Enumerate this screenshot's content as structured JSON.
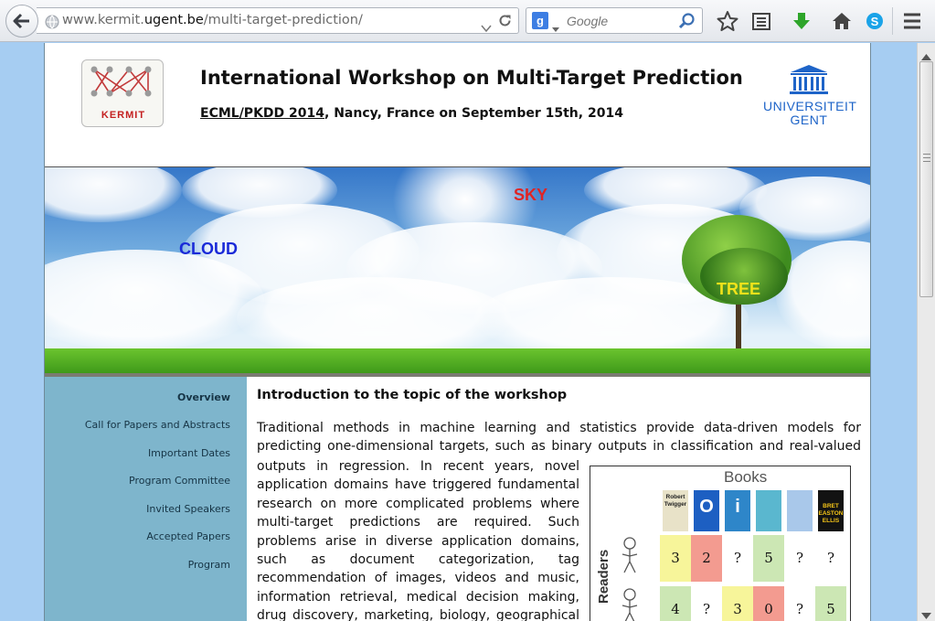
{
  "browser": {
    "url_prefix": "www.kermit.",
    "url_host": "ugent.be",
    "url_path": "/multi-target-prediction/",
    "search_placeholder": "Google",
    "search_engine_glyph": "g"
  },
  "header": {
    "logo_text": "KERMIT",
    "title": "International Workshop on Multi-Target Prediction",
    "conference_link": "ECML/PKDD 2014",
    "subtitle_rest": ", Nancy, France on September 15th, 2014",
    "university_line1": "UNIVERSITEIT",
    "university_line2": "GENT"
  },
  "banner": {
    "sky_label": "SKY",
    "cloud_label": "CLOUD",
    "tree_label": "TREE"
  },
  "sidebar": {
    "items": [
      {
        "label": "Overview",
        "active": true
      },
      {
        "label": "Call for Papers and Abstracts",
        "active": false
      },
      {
        "label": "Important Dates",
        "active": false
      },
      {
        "label": "Program Committee",
        "active": false
      },
      {
        "label": "Invited Speakers",
        "active": false
      },
      {
        "label": "Accepted Papers",
        "active": false
      },
      {
        "label": "Program",
        "active": false
      }
    ]
  },
  "content": {
    "heading": "Introduction to the topic of the workshop",
    "para_full": "Traditional methods in machine learning and statistics provide data-driven models for predicting one-dimensional targets, such as binary outputs in classification and real-valued",
    "para_lines": [
      "outputs in regression. In recent years, novel",
      "application domains have triggered fundamental",
      "research on more complicated problems where",
      "multi-target predictions are required. Such",
      "problems arise in diverse application domains,",
      "such as document categorization, tag",
      "recommendation of images, videos and music,",
      "information retrieval, medical decision making,",
      "drug discovery, marketing, biology, geographical"
    ]
  },
  "figure": {
    "title": "Books",
    "row_label": "Readers",
    "book_covers": [
      {
        "label": "Robert Twigger",
        "color": "#e8e2c8"
      },
      {
        "label": "O",
        "color": "#1d5fc2"
      },
      {
        "label": "i",
        "color": "#2e86c9"
      },
      {
        "label": "",
        "color": "#5ab7cf"
      },
      {
        "label": "",
        "color": "#a9c8ea"
      },
      {
        "label": "BRET EASTON ELLIS",
        "color": "#121212"
      }
    ],
    "rows": [
      {
        "cells": [
          {
            "v": "3",
            "bg": "#f7f59a"
          },
          {
            "v": "2",
            "bg": "#f39b90"
          },
          {
            "v": "?",
            "bg": "#ffffff"
          },
          {
            "v": "5",
            "bg": "#cce7b4"
          },
          {
            "v": "?",
            "bg": "#ffffff"
          },
          {
            "v": "?",
            "bg": "#ffffff"
          }
        ]
      },
      {
        "cells": [
          {
            "v": "4",
            "bg": "#cce7b4"
          },
          {
            "v": "?",
            "bg": "#ffffff"
          },
          {
            "v": "3",
            "bg": "#f7f59a"
          },
          {
            "v": "0",
            "bg": "#f39b90"
          },
          {
            "v": "?",
            "bg": "#ffffff"
          },
          {
            "v": "5",
            "bg": "#cce7b4"
          }
        ]
      }
    ]
  },
  "colors": {
    "sidebar_bg": "#7eb5cc",
    "page_bg": "#a6cdf2",
    "ugent_blue": "#1e64c8",
    "kermit_red": "#c42020"
  }
}
